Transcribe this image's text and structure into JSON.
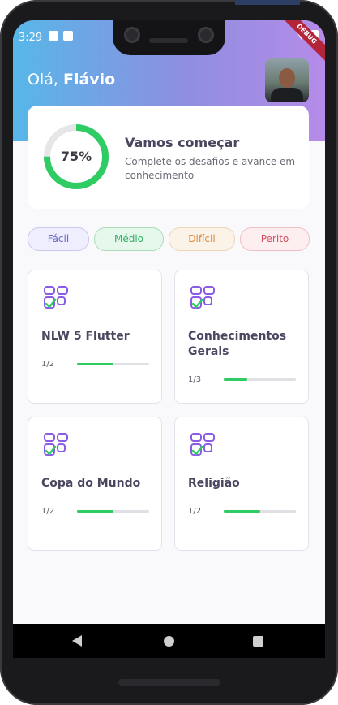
{
  "status_bar": {
    "time": "3:29",
    "debug_label": "DEBUG"
  },
  "header": {
    "greeting_prefix": "Olá, ",
    "user_name": "Flávio"
  },
  "progress_card": {
    "percent": 75,
    "percent_label": "75%",
    "title": "Vamos começar",
    "subtitle": "Complete os desafios e avance em conhecimento"
  },
  "levels": [
    {
      "label": "Fácil"
    },
    {
      "label": "Médio"
    },
    {
      "label": "Difícil"
    },
    {
      "label": "Perito"
    }
  ],
  "quizzes": [
    {
      "title": "NLW 5 Flutter",
      "count": "1/2",
      "progress": 0.5
    },
    {
      "title": "Conhecimentos Gerais",
      "count": "1/3",
      "progress": 0.33
    },
    {
      "title": "Copa do Mundo",
      "count": "1/2",
      "progress": 0.5
    },
    {
      "title": "Religião",
      "count": "1/2",
      "progress": 0.5
    }
  ],
  "colors": {
    "accent_green": "#2fcc63",
    "header_gradient_start": "#57b7e8",
    "header_gradient_end": "#b58be8",
    "title_text": "#4a4660",
    "icon_purple": "#8a5ce6"
  },
  "icons": {
    "quiz": "checklist-grid-icon",
    "nav_back": "back-triangle-icon",
    "nav_home": "home-circle-icon",
    "nav_recent": "recent-square-icon"
  }
}
